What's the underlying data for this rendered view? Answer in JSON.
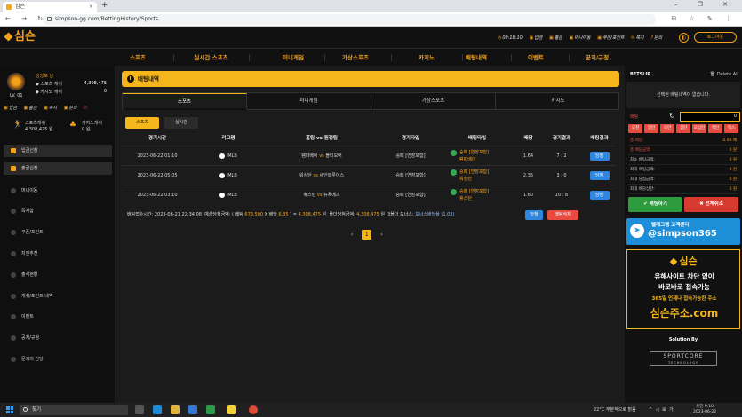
{
  "browser": {
    "tab_title": "심슨",
    "new_tab": "+",
    "url": "simpson-gg.com/BettingHistory/Sports",
    "nav": "←  →  ↻  ⌂",
    "tools": "⊞ ☆ ✎ ⋮",
    "window_controls": "–  ❐  ✕"
  },
  "site": {
    "logo": "심슨",
    "toplinks": [
      {
        "icon": "◷",
        "label": "09:18:10"
      },
      {
        "icon": "▣",
        "label": "입금"
      },
      {
        "icon": "▣",
        "label": "출금"
      },
      {
        "icon": "▣",
        "label": "머니이동"
      },
      {
        "icon": "▣",
        "label": "쿠폰/포인트"
      },
      {
        "icon": "✉",
        "label": "쪽지"
      },
      {
        "icon": "?",
        "label": "문의"
      }
    ],
    "sound_icon": "◐",
    "logout": "로그아웃"
  },
  "mainnav": [
    "스포츠",
    "실시간 스포츠",
    "미니게임",
    "가상스포츠",
    "카지노",
    "배팅내역",
    "이벤트",
    "공지/규정"
  ],
  "profile": {
    "name": "잉잉모 님",
    "level": "LV. 01",
    "sports_label": "◆ 스포츠 캐쉬",
    "sports_value": "4,308,475",
    "casino_label": "◆ 카지노 캐쉬",
    "casino_value": "0"
  },
  "quick": [
    {
      "label": "입금"
    },
    {
      "label": "출금"
    },
    {
      "label": "쪽지"
    },
    {
      "label": "문의"
    }
  ],
  "quick_power": "⏻",
  "cash": {
    "sports": {
      "label": "스포츠캐쉬",
      "value": "4,308,475 원"
    },
    "casino": {
      "label": "카지노캐쉬",
      "value": "0 원"
    }
  },
  "sidemenu": [
    "입금신청",
    "출금신청",
    "머니이동",
    "쪽지함",
    "쿠폰/포인트",
    "지인추천",
    "출석현황",
    "캐쉬/포인트 내역",
    "이벤트",
    "공지/규정",
    "문의의 전당"
  ],
  "page": {
    "title": "배팅내역",
    "tabs": [
      "스포츠",
      "미니게임",
      "가상스포츠",
      "카지노"
    ],
    "subtabs": [
      "스포츠",
      "실시간"
    ],
    "columns": [
      "경기시간",
      "리그명",
      "홈팀 vs 원정팀",
      "경기타입",
      "배팅타입",
      "배당",
      "경기결과",
      "배팅결과"
    ]
  },
  "bets": [
    {
      "time": "2023-06-22 01:10",
      "league": "MLB",
      "home": "템파베이",
      "vs": "vs",
      "away": "볼티모어",
      "type": "승패 [연장포함]",
      "pick1": "승패 [연장포함]",
      "pick2": "템파베이",
      "odds": "1.64",
      "score": "7 : 2",
      "result": "당첨"
    },
    {
      "time": "2023-06-22 05:05",
      "league": "MLB",
      "home": "워싱턴",
      "vs": "vs",
      "away": "세인트루이스",
      "type": "승패 [연장포함]",
      "pick1": "승패 [연장포함]",
      "pick2": "워싱턴",
      "odds": "2.35",
      "score": "3 : 0",
      "result": "당첨"
    },
    {
      "time": "2023-06-22 03:10",
      "league": "MLB",
      "home": "휴스턴",
      "vs": "vs",
      "away": "뉴욕메츠",
      "type": "승패 [연장포함]",
      "pick1": "승패 [연장포함]",
      "pick2": "휴스턴",
      "odds": "1.60",
      "score": "10 : 8",
      "result": "당첨"
    }
  ],
  "summary": {
    "bet_time": "배팅접수시간: 2023-06-21 22:34:08",
    "expected_pre": "예상당첨금액: ( 배팅",
    "stake": "678,500",
    "x": "X 배당",
    "odds": "6.35",
    "eq": ") =",
    "expected": "4,308,475",
    "won": "원",
    "payout_label": "폴더당첨금액:",
    "payout": "4,308,475",
    "won2": "원",
    "bonus_label": "3폴더 보너스:",
    "bonus": "보너스배당율 (1.03)",
    "win_btn": "당첨",
    "delete_btn": "배팅삭제"
  },
  "pager": {
    "prev": "‹",
    "current": "1",
    "next": "›"
  },
  "betslip": {
    "title": "BETSLIP",
    "delete_all": "🗑 Delete All",
    "empty": "선택된 배팅내역이 없습니다.",
    "bet_label": "배팅",
    "refresh": "↻",
    "amount": "0",
    "chips": [
      "오천",
      "일만",
      "오만",
      "십만",
      "오십만",
      "백만",
      "맥스"
    ],
    "rows": [
      {
        "label": "총 배당:",
        "value": "0.00 배",
        "red": true
      },
      {
        "label": "총 배당금액:",
        "value": "0 원",
        "red": true
      },
      {
        "label": "최소 배팅금액:",
        "value": "0 원",
        "red": false
      },
      {
        "label": "최대 배팅금액:",
        "value": "0 원",
        "red": false
      },
      {
        "label": "최대 당첨금액:",
        "value": "0 원",
        "red": false
      },
      {
        "label": "최대 배당상한:",
        "value": "0 원",
        "red": false
      }
    ],
    "bet_btn": "✔ 배팅하기",
    "clear_btn": "✖ 전체취소"
  },
  "banners": {
    "telegram_title": "텔레그램 고객센터",
    "telegram_handle": "@simpson365",
    "ad_logo": "심슨",
    "ad_line1": "유해사이트 차단 없이",
    "ad_line2": "바로바로 접속가능",
    "ad_line3": "365일 언제나 접속가능한 주소",
    "ad_domain": "심슨주소.com",
    "solution_by": "Solution By",
    "sportcore": "SPORTCORE",
    "sportcore_sub": "TECHNOLOGY"
  },
  "taskbar": {
    "search": "찾기",
    "weather": "22°C  부분적으로 맑음",
    "tray": "^ ◁ ⊞ 가",
    "time": "오전 9:10",
    "date": "2023-06-22"
  },
  "colors": {
    "accent": "#f4b61b",
    "win_badge": "#2f86de",
    "danger": "#e84a3f",
    "success": "#2e9b3f",
    "telegram": "#1d8ed8"
  }
}
